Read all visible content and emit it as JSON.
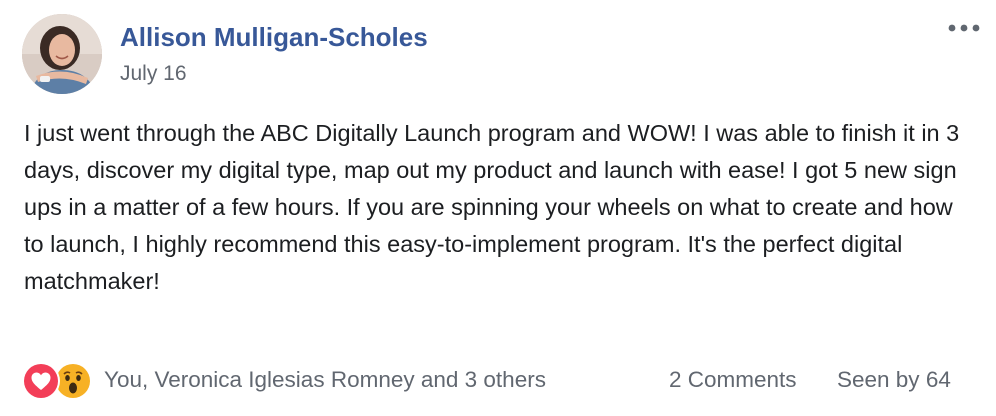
{
  "post": {
    "author": "Allison Mulligan-Scholes",
    "date": "July 16",
    "more_icon": "more-horizontal-icon",
    "text": "I just went through the ABC Digitally Launch program and WOW! I was able to finish it in 3 days, discover my digital type, map out my product and launch with ease! I got 5 new sign ups in a matter of a few hours. If you are spinning your wheels on what to create and how to launch, I highly recommend this easy-to-implement program. It's the perfect digital matchmaker!"
  },
  "footer": {
    "reactions": [
      "love-reaction-icon",
      "wow-reaction-icon"
    ],
    "reactors": "You, Veronica Iglesias Romney and 3 others",
    "comments": "2 Comments",
    "seen": "Seen by 64"
  },
  "colors": {
    "author_link": "#385898",
    "secondary_text": "#616770",
    "body_text": "#1c1e21",
    "love": "#f33e58",
    "wow": "#f7b125"
  }
}
